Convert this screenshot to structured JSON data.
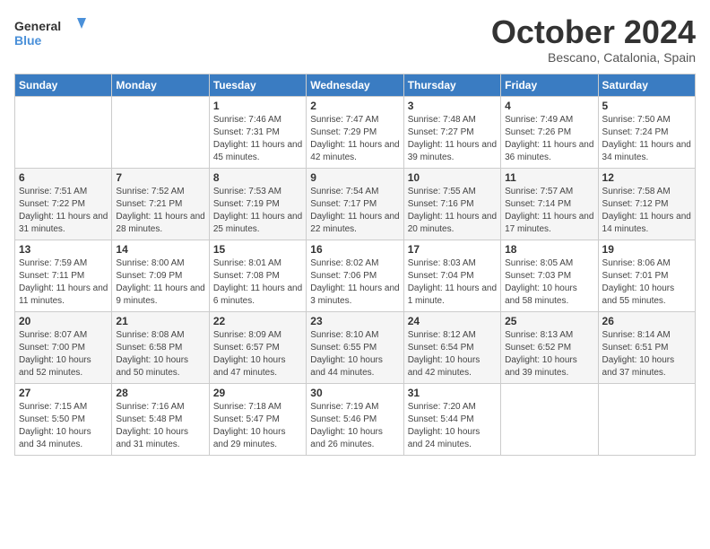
{
  "header": {
    "logo_line1": "General",
    "logo_line2": "Blue",
    "month_title": "October 2024",
    "location": "Bescano, Catalonia, Spain"
  },
  "weekdays": [
    "Sunday",
    "Monday",
    "Tuesday",
    "Wednesday",
    "Thursday",
    "Friday",
    "Saturday"
  ],
  "weeks": [
    [
      {
        "day": "",
        "info": ""
      },
      {
        "day": "",
        "info": ""
      },
      {
        "day": "1",
        "info": "Sunrise: 7:46 AM\nSunset: 7:31 PM\nDaylight: 11 hours and 45 minutes."
      },
      {
        "day": "2",
        "info": "Sunrise: 7:47 AM\nSunset: 7:29 PM\nDaylight: 11 hours and 42 minutes."
      },
      {
        "day": "3",
        "info": "Sunrise: 7:48 AM\nSunset: 7:27 PM\nDaylight: 11 hours and 39 minutes."
      },
      {
        "day": "4",
        "info": "Sunrise: 7:49 AM\nSunset: 7:26 PM\nDaylight: 11 hours and 36 minutes."
      },
      {
        "day": "5",
        "info": "Sunrise: 7:50 AM\nSunset: 7:24 PM\nDaylight: 11 hours and 34 minutes."
      }
    ],
    [
      {
        "day": "6",
        "info": "Sunrise: 7:51 AM\nSunset: 7:22 PM\nDaylight: 11 hours and 31 minutes."
      },
      {
        "day": "7",
        "info": "Sunrise: 7:52 AM\nSunset: 7:21 PM\nDaylight: 11 hours and 28 minutes."
      },
      {
        "day": "8",
        "info": "Sunrise: 7:53 AM\nSunset: 7:19 PM\nDaylight: 11 hours and 25 minutes."
      },
      {
        "day": "9",
        "info": "Sunrise: 7:54 AM\nSunset: 7:17 PM\nDaylight: 11 hours and 22 minutes."
      },
      {
        "day": "10",
        "info": "Sunrise: 7:55 AM\nSunset: 7:16 PM\nDaylight: 11 hours and 20 minutes."
      },
      {
        "day": "11",
        "info": "Sunrise: 7:57 AM\nSunset: 7:14 PM\nDaylight: 11 hours and 17 minutes."
      },
      {
        "day": "12",
        "info": "Sunrise: 7:58 AM\nSunset: 7:12 PM\nDaylight: 11 hours and 14 minutes."
      }
    ],
    [
      {
        "day": "13",
        "info": "Sunrise: 7:59 AM\nSunset: 7:11 PM\nDaylight: 11 hours and 11 minutes."
      },
      {
        "day": "14",
        "info": "Sunrise: 8:00 AM\nSunset: 7:09 PM\nDaylight: 11 hours and 9 minutes."
      },
      {
        "day": "15",
        "info": "Sunrise: 8:01 AM\nSunset: 7:08 PM\nDaylight: 11 hours and 6 minutes."
      },
      {
        "day": "16",
        "info": "Sunrise: 8:02 AM\nSunset: 7:06 PM\nDaylight: 11 hours and 3 minutes."
      },
      {
        "day": "17",
        "info": "Sunrise: 8:03 AM\nSunset: 7:04 PM\nDaylight: 11 hours and 1 minute."
      },
      {
        "day": "18",
        "info": "Sunrise: 8:05 AM\nSunset: 7:03 PM\nDaylight: 10 hours and 58 minutes."
      },
      {
        "day": "19",
        "info": "Sunrise: 8:06 AM\nSunset: 7:01 PM\nDaylight: 10 hours and 55 minutes."
      }
    ],
    [
      {
        "day": "20",
        "info": "Sunrise: 8:07 AM\nSunset: 7:00 PM\nDaylight: 10 hours and 52 minutes."
      },
      {
        "day": "21",
        "info": "Sunrise: 8:08 AM\nSunset: 6:58 PM\nDaylight: 10 hours and 50 minutes."
      },
      {
        "day": "22",
        "info": "Sunrise: 8:09 AM\nSunset: 6:57 PM\nDaylight: 10 hours and 47 minutes."
      },
      {
        "day": "23",
        "info": "Sunrise: 8:10 AM\nSunset: 6:55 PM\nDaylight: 10 hours and 44 minutes."
      },
      {
        "day": "24",
        "info": "Sunrise: 8:12 AM\nSunset: 6:54 PM\nDaylight: 10 hours and 42 minutes."
      },
      {
        "day": "25",
        "info": "Sunrise: 8:13 AM\nSunset: 6:52 PM\nDaylight: 10 hours and 39 minutes."
      },
      {
        "day": "26",
        "info": "Sunrise: 8:14 AM\nSunset: 6:51 PM\nDaylight: 10 hours and 37 minutes."
      }
    ],
    [
      {
        "day": "27",
        "info": "Sunrise: 7:15 AM\nSunset: 5:50 PM\nDaylight: 10 hours and 34 minutes."
      },
      {
        "day": "28",
        "info": "Sunrise: 7:16 AM\nSunset: 5:48 PM\nDaylight: 10 hours and 31 minutes."
      },
      {
        "day": "29",
        "info": "Sunrise: 7:18 AM\nSunset: 5:47 PM\nDaylight: 10 hours and 29 minutes."
      },
      {
        "day": "30",
        "info": "Sunrise: 7:19 AM\nSunset: 5:46 PM\nDaylight: 10 hours and 26 minutes."
      },
      {
        "day": "31",
        "info": "Sunrise: 7:20 AM\nSunset: 5:44 PM\nDaylight: 10 hours and 24 minutes."
      },
      {
        "day": "",
        "info": ""
      },
      {
        "day": "",
        "info": ""
      }
    ]
  ]
}
